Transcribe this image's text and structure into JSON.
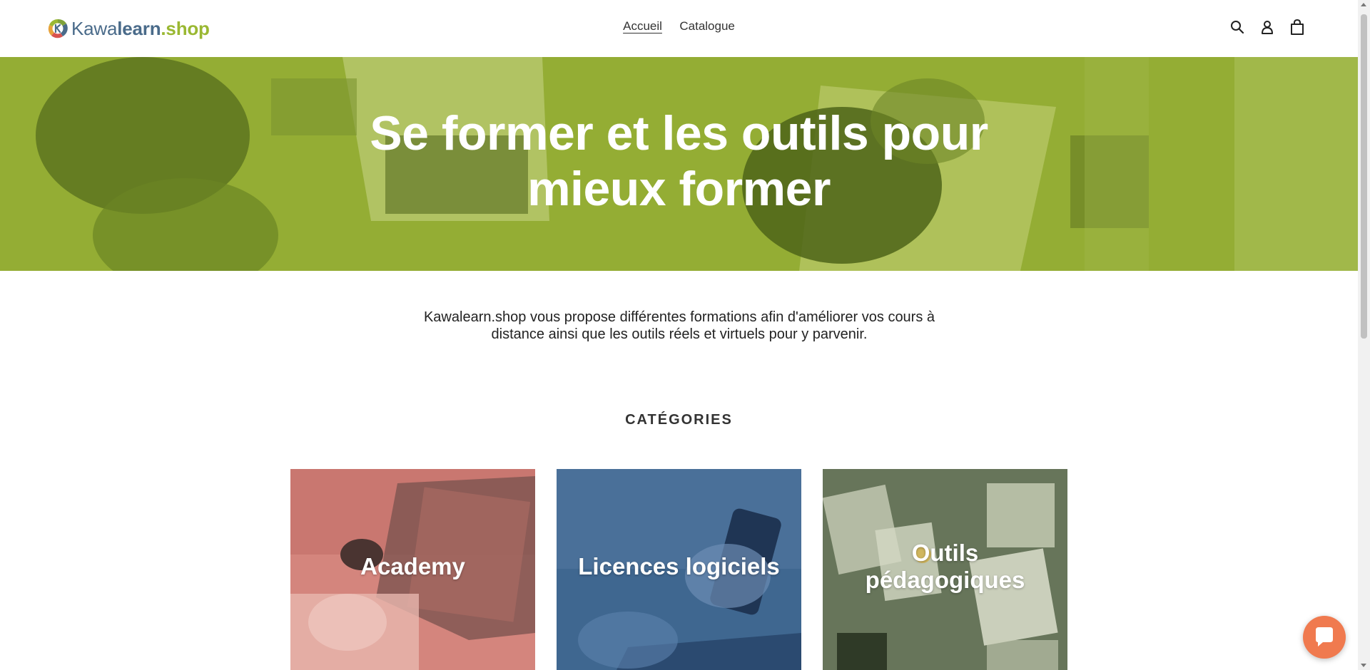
{
  "header": {
    "logo": {
      "part1": "Kawa",
      "part2": "learn",
      "part3": ".shop"
    },
    "nav": [
      {
        "label": "Accueil"
      },
      {
        "label": "Catalogue"
      }
    ],
    "icons": [
      "search-icon",
      "account-icon",
      "cart-icon"
    ]
  },
  "hero": {
    "title_line1": "Se former et les outils pour",
    "title_line2": "mieux former"
  },
  "intro": {
    "text": "Kawalearn.shop vous propose différentes formations afin d'améliorer vos cours à distance ainsi que les outils réels et virtuels pour y parvenir."
  },
  "categories": {
    "title": "CATÉGORIES",
    "items": [
      {
        "label": "Academy"
      },
      {
        "label": "Licences logiciels"
      },
      {
        "label_line1": "Outils",
        "label_line2": "pédagogiques"
      }
    ]
  },
  "colors": {
    "brand_green": "#9ab832",
    "brand_blue": "#4a6b8a",
    "hero_overlay": "#8faa2e",
    "academy_overlay": "#c96a63",
    "licences_overlay": "#3c6289",
    "outils_overlay": "#6e7c5e",
    "chat": "#f07a4f"
  }
}
